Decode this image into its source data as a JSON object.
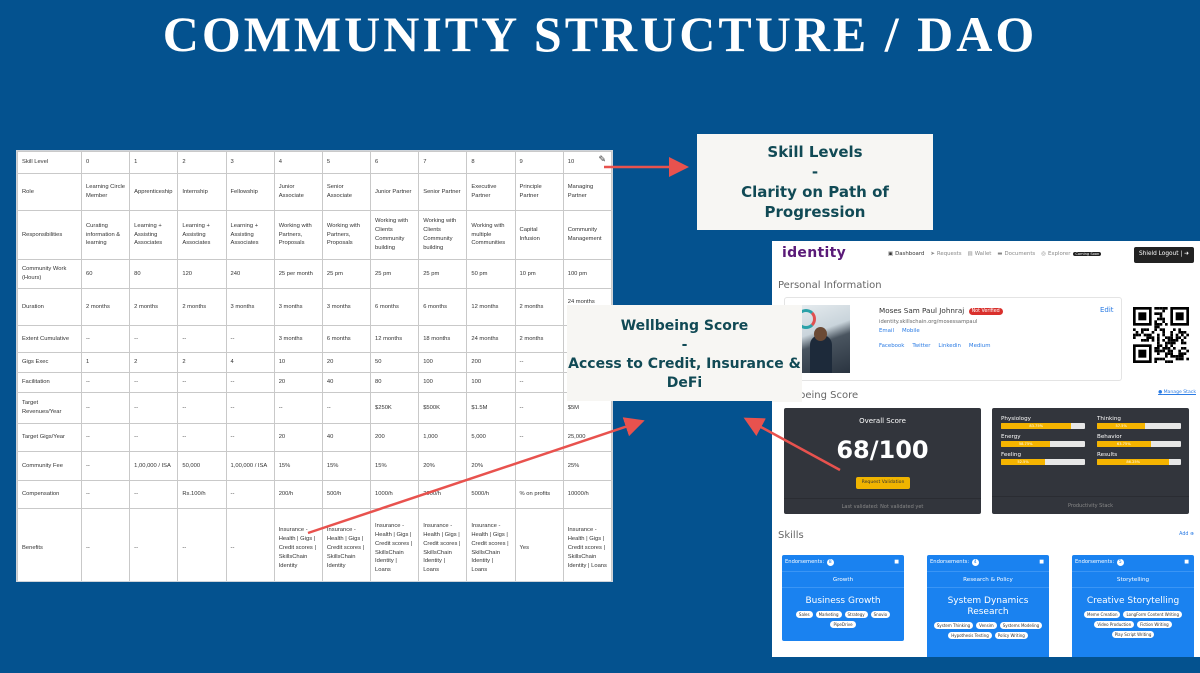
{
  "title": "COMMUNITY STRUCTURE / DAO",
  "table": {
    "rows": [
      {
        "key": "level",
        "cells": [
          "Skill Level",
          "0",
          "1",
          "2",
          "3",
          "4",
          "5",
          "6",
          "7",
          "8",
          "9",
          "10"
        ]
      },
      {
        "key": "role",
        "cells": [
          "Role",
          "Learning Circle Member",
          "Apprenticeship",
          "Internship",
          "Fellowship",
          "Junior Associate",
          "Senior Associate",
          "Junior Partner",
          "Senior Partner",
          "Executive Partner",
          "Principle Partner",
          "Managing Partner"
        ]
      },
      {
        "key": "resp",
        "cells": [
          "Responsibilities",
          "Curating information & learning",
          "Learning + Assisting Associates",
          "Learning + Assisting Associates",
          "Learning + Assisting Associates",
          "Working with Partners, Proposals",
          "Working with Partners, Proposals",
          "Working with Clients Community building",
          "Working with Clients Community building",
          "Working with multiple Communities",
          "Capital Infusion",
          "Community Management"
        ]
      },
      {
        "key": "comm",
        "cells": [
          "Community Work (Hours)",
          "60",
          "80",
          "120",
          "240",
          "25 per month",
          "25 pm",
          "25 pm",
          "25 pm",
          "50 pm",
          "10 pm",
          "100 pm"
        ]
      },
      {
        "key": "dur",
        "cells": [
          "Duration",
          "2 months",
          "2 months",
          "2 months",
          "3 months",
          "3 months",
          "3 months",
          "6 months",
          "6 months",
          "12 months",
          "2 months",
          "24 months Rotation /"
        ]
      },
      {
        "key": "ext",
        "cells": [
          "Extent Cumulative",
          "--",
          "--",
          "--",
          "--",
          "3 months",
          "6 months",
          "12 months",
          "18 months",
          "24 months",
          "2 months",
          ""
        ]
      },
      {
        "key": "gigs",
        "cells": [
          "Gigs Exec",
          "1",
          "2",
          "2",
          "4",
          "10",
          "20",
          "50",
          "100",
          "200",
          "--",
          ""
        ]
      },
      {
        "key": "fac",
        "cells": [
          "Facilitation",
          "--",
          "--",
          "--",
          "--",
          "20",
          "40",
          "80",
          "100",
          "100",
          "--",
          ""
        ]
      },
      {
        "key": "rev",
        "cells": [
          "Target Revenues/Year",
          "--",
          "--",
          "--",
          "--",
          "--",
          "--",
          "$250K",
          "$500K",
          "$1.5M",
          "--",
          "$5M"
        ]
      },
      {
        "key": "tgig",
        "cells": [
          "Target Gigs/Year",
          "--",
          "--",
          "--",
          "--",
          "20",
          "40",
          "200",
          "1,000",
          "5,000",
          "--",
          "25,000"
        ]
      },
      {
        "key": "fee",
        "cells": [
          "Community Fee",
          "--",
          "1,00,000 / ISA",
          "50,000",
          "1,00,000 / ISA",
          "15%",
          "15%",
          "15%",
          "20%",
          "20%",
          "",
          "25%"
        ]
      },
      {
        "key": "comp",
        "cells": [
          "Compensation",
          "--",
          "--",
          "Rs.100/h",
          "--",
          "200/h",
          "500/h",
          "1000/h",
          "2000/h",
          "5000/h",
          "% on profits",
          "10000/h"
        ]
      },
      {
        "key": "ben",
        "cells": [
          "Benefits",
          "--",
          "--",
          "--",
          "--",
          "Insurance - Health | Gigs | Credit scores | SkillsChain Identity",
          "Insurance - Health | Gigs | Credit scores | SkillsChain Identity",
          "Insurance - Health | Gigs | Credit scores | SkillsChain Identity | Loans",
          "Insurance - Health | Gigs | Credit scores | SkillsChain Identity | Loans",
          "Insurance - Health | Gigs | Credit scores | SkillsChain Identity | Loans",
          "Yes",
          "Insurance - Health | Gigs | Credit scores | SkillsChain Identity | Loans"
        ]
      }
    ]
  },
  "callouts": {
    "skill": {
      "line1": "Skill Levels",
      "line2": "-",
      "line3": "Clarity on Path of Progression"
    },
    "wellbeing": {
      "line1": "Wellbeing Score",
      "line2": "-",
      "line3": "Access to Credit, Insurance & DeFi"
    }
  },
  "app": {
    "logo": "identity",
    "nav": [
      {
        "label": "Dashboard",
        "icon": "dashboard-icon",
        "active": true
      },
      {
        "label": "Requests",
        "icon": "requests-icon",
        "active": false
      },
      {
        "label": "Wallet",
        "icon": "wallet-icon",
        "active": false
      },
      {
        "label": "Documents",
        "icon": "folder-icon",
        "active": false
      },
      {
        "label": "Explorer",
        "icon": "explorer-icon",
        "active": false,
        "badge": "Coming Soon"
      }
    ],
    "logout_label": "Shield Logout |",
    "personal_info_title": "Personal Information",
    "profile": {
      "name": "Moses Sam Paul Johnraj",
      "status": "Not Verified",
      "url": "identity.skillschain.org/mosessampaul",
      "links1": [
        "Email",
        "Mobile"
      ],
      "links2": [
        "Facebook",
        "Twitter",
        "Linkedin",
        "Medium"
      ],
      "edit_label": "Edit"
    },
    "wellbeing_title": "Wellbeing Score",
    "manage_stack_label": "Manage Stack",
    "overall": {
      "label": "Overall Score",
      "value": "68/100",
      "button": "Request Validation",
      "footer": "Last validated: Not validated yet"
    },
    "stack": {
      "footer": "Productivity Stack",
      "metrics": [
        {
          "label": "Physiology",
          "pct": 83.75
        },
        {
          "label": "Thinking",
          "pct": 57.5
        },
        {
          "label": "Energy",
          "pct": 58.75
        },
        {
          "label": "Behavior",
          "pct": 63.75
        },
        {
          "label": "Feeling",
          "pct": 52.5
        },
        {
          "label": "Results",
          "pct": 86.25
        }
      ]
    },
    "skills_title": "Skills",
    "add_label": "Add",
    "skills": [
      {
        "endorsements": "8",
        "category": "Growth",
        "name": "Business Growth",
        "tags": [
          "Sales",
          "Marketing",
          "Strategy",
          "Snovio",
          "PipeDrive"
        ]
      },
      {
        "endorsements": "4",
        "category": "Research & Policy",
        "name": "System Dynamics Research",
        "tags": [
          "System Thinking",
          "Vensim",
          "Systems Modeling",
          "Hypothesis Testing",
          "Policy Writing"
        ]
      },
      {
        "endorsements": "5",
        "category": "Storytelling",
        "name": "Creative Storytelling",
        "tags": [
          "Meme Creation",
          "LongForm Content Writing",
          "Video Production",
          "Fiction Writing",
          "Play Script Writing"
        ]
      }
    ],
    "endorsements_label": "Endorsements:"
  },
  "colors": {
    "background": "#04528f",
    "callout_text": "#114a55",
    "arrow": "#e8524e",
    "skill_card": "#1a82f0",
    "bar_fill": "#f5b400",
    "not_verified": "#d9302c"
  }
}
